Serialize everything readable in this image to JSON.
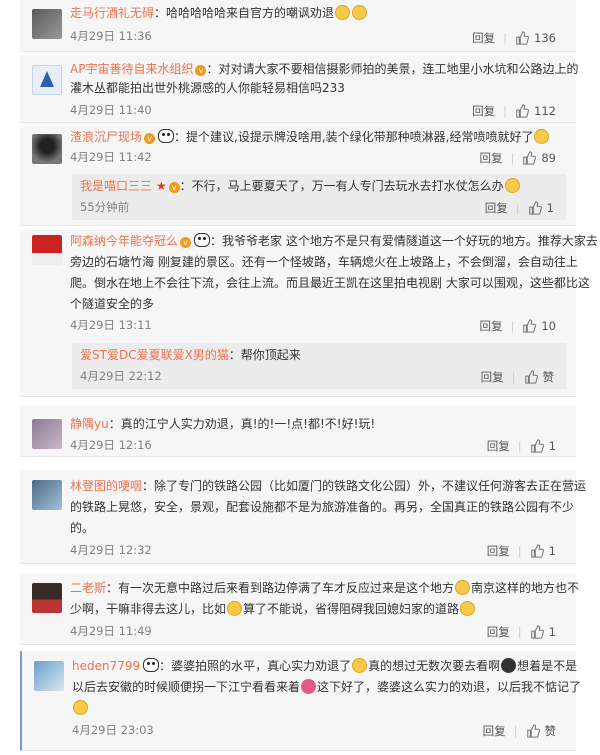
{
  "labels": {
    "reply": "回复",
    "zan": "赞"
  },
  "comments": [
    {
      "user": "走马行酒礼无碍",
      "text": "：哈哈哈哈哈来自官方的嘲讽劝退",
      "time": "4月29日 11:36",
      "likes": "136"
    },
    {
      "user": "AP宇宙善待自来水组织",
      "text_1": "：对对请大家不要相信摄影师拍的美景，连工地里小水坑和公路边上的",
      "text_2": "灌木丛都能拍出世外桃源感的人你能轻易相信吗233",
      "time": "4月29日 11:40",
      "likes": "112"
    },
    {
      "user": "渣浪沉尸现场",
      "text": "：提个建议,设提示牌没啥用,装个绿化带那种喷淋器,经常喷喷就好了",
      "time": "4月29日 11:42",
      "likes": "89",
      "reply": {
        "user": "我是喵口三三",
        "text": "：不行，马上要夏天了，万一有人专门去玩水去打水仗怎么办",
        "time": "55分钟前",
        "likes": "1"
      }
    },
    {
      "user": "阿森纳今年能夺冠么",
      "text_1": "：我爷爷老家 这个地方不是只有爱情隧道这一个好玩的地方。推荐大家去",
      "text_2": "旁边的石塘竹海 刚复建的景区。还有一个怪坡路，车辆熄火在上坡路上，不会倒溜，会自动往上",
      "text_3": "爬。倒水在地上不会往下流，会往上流。而且最近王凯在这里拍电视剧 大家可以围观，这些都比这",
      "text_4": "个隧道安全的多",
      "time": "4月29日 13:11",
      "likes": "10",
      "reply": {
        "user": "爱ST爱DC爱夏联爱X男的猫",
        "text": "：帮你顶起来",
        "time": "4月29日 22:12"
      }
    },
    {
      "user": "静隅yu",
      "text": "：真的江宁人实力劝退，真!的!一!点!都!不!好!玩!",
      "time": "4月29日 12:16",
      "likes": "1"
    },
    {
      "user": "林登图的哽咽",
      "text_1": "：除了专门的铁路公园（比如厦门的铁路文化公园）外，不建议任何游客去正在营运",
      "text_2": "的铁路上晃悠，安全，景观，配套设施都不是为旅游准备的。再另，全国真正的铁路公园有不少",
      "text_3": "的。",
      "time": "4月29日 12:32",
      "likes": "1"
    },
    {
      "user": "二老斯",
      "text_1": "：有一次无意中路过后来看到路边停满了车才反应过来是这个地方",
      "text_1b": "南京这样的地方也不",
      "text_2": "少啊，干嘛非得去这儿，比如",
      "text_2b": "算了不能说，省得阻碍我回媳妇家的道路",
      "time": "4月29日 11:49",
      "likes": "1"
    },
    {
      "user": "heden7799",
      "text_1": "：婆婆拍照的水平，真心实力劝退了",
      "text_1b": "真的想过无数次要去看啊",
      "text_1c": "想着是不是",
      "text_2": "以后去安徽的时候顺便拐一下江宁看看来着",
      "text_2b": "这下好了，婆婆这么实力的劝退，以后我不惦记了",
      "time": "4月29日 23:03"
    }
  ]
}
